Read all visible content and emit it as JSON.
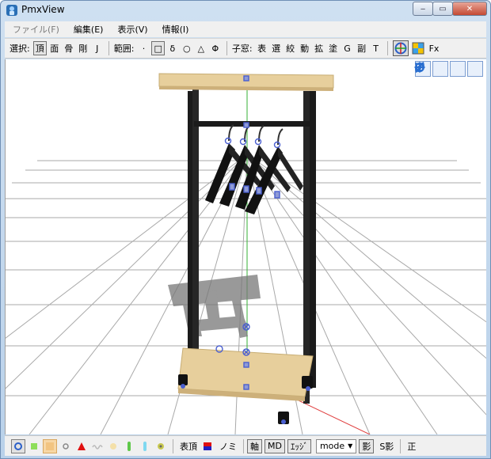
{
  "window": {
    "title": "PmxView",
    "minimize_glyph": "‒",
    "maximize_glyph": "▭",
    "close_glyph": "✕"
  },
  "menu": {
    "items": [
      {
        "label": "ファイル(F)",
        "enabled": false
      },
      {
        "label": "編集(E)",
        "enabled": true
      },
      {
        "label": "表示(V)",
        "enabled": true
      },
      {
        "label": "情報(I)",
        "enabled": true
      }
    ]
  },
  "toolbar": {
    "select_label": "選択:",
    "select_modes": [
      "頂",
      "面",
      "骨",
      "剛",
      "J"
    ],
    "range_label": "範囲:",
    "range_modes": [
      "·",
      "□",
      "δ",
      "○",
      "△",
      "Φ"
    ],
    "child_label": "子窓:",
    "child_windows": [
      "表",
      "選",
      "絞",
      "動",
      "拡",
      "塗",
      "G",
      "副",
      "T"
    ],
    "fx_label": "Fx"
  },
  "viewport": {
    "tools": [
      "move-xy-icon",
      "move-all-icon",
      "move-z-icon",
      "rotate-icon"
    ]
  },
  "statusbar": {
    "label_surface_vertex": "表頂",
    "label_no": "ノミ",
    "label_axis": "軸",
    "label_md": "MD",
    "label_edge": "ｴｯｼﾞ",
    "mode_label": "mode",
    "label_shadow": "影",
    "label_sshadow": "S影",
    "label_ortho": "正"
  },
  "colors": {
    "accent": "#3f6fd0",
    "wood": "#e7cf9c",
    "frame": "#1b1b1b",
    "grid": "#a9a9a9"
  }
}
